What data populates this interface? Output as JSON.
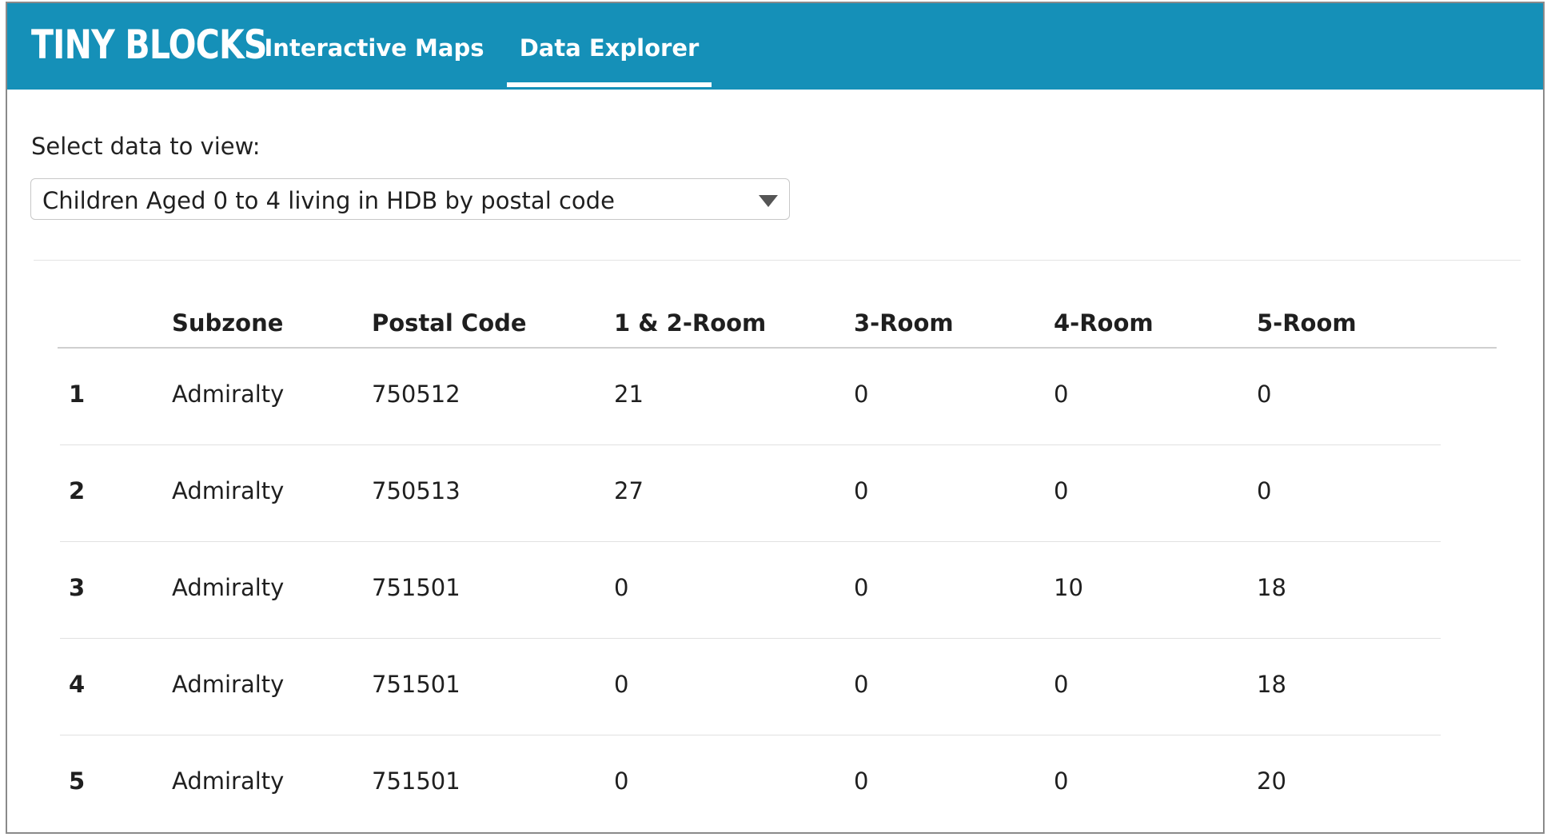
{
  "app": {
    "logo": "TINY BLOCKS"
  },
  "nav": {
    "tabs": [
      {
        "label": "Interactive Maps"
      },
      {
        "label": "Data Explorer"
      }
    ],
    "active_tab": "Data Explorer"
  },
  "selector": {
    "label": "Select data to view:",
    "selected_value": "Children Aged 0 to 4 living in HDB by postal code"
  },
  "table": {
    "columns": [
      "",
      "Subzone",
      "Postal Code",
      "1 & 2-Room",
      "3-Room",
      "4-Room",
      "5-Room"
    ],
    "rows": [
      [
        "1",
        "Admiralty",
        "750512",
        "21",
        "0",
        "0",
        "0"
      ],
      [
        "2",
        "Admiralty",
        "750513",
        "27",
        "0",
        "0",
        "0"
      ],
      [
        "3",
        "Admiralty",
        "751501",
        "0",
        "0",
        "10",
        "18"
      ],
      [
        "4",
        "Admiralty",
        "751501",
        "0",
        "0",
        "0",
        "18"
      ],
      [
        "5",
        "Admiralty",
        "751501",
        "0",
        "0",
        "0",
        "20"
      ]
    ]
  },
  "colors": {
    "header_bg": "#1590b8",
    "header_text": "#ffffff"
  }
}
